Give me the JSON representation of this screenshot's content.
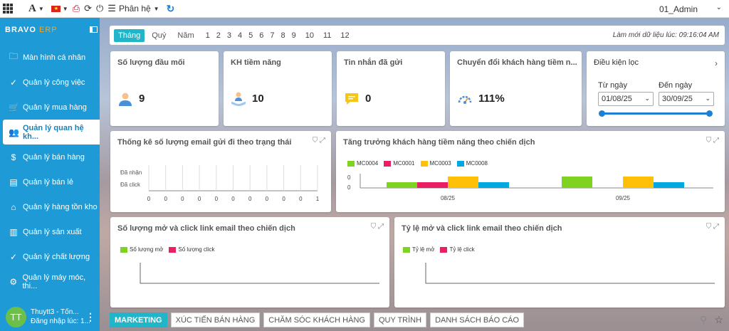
{
  "topbar": {
    "menu_label": "Phân hệ",
    "user": "01_Admin",
    "font_glyph": "A"
  },
  "sidebar": {
    "brand": "BRAVO",
    "brand_suffix": " ERP",
    "items": [
      {
        "label": "Màn hình cá nhân",
        "icon": "folder-icon",
        "glyph": "🗀"
      },
      {
        "label": "Quản lý công việc",
        "icon": "check-circle-icon",
        "glyph": "✓"
      },
      {
        "label": "Quản lý mua hàng",
        "icon": "cart-icon",
        "glyph": "🛒"
      },
      {
        "label": "Quản lý quan hệ kh...",
        "icon": "people-icon",
        "glyph": "👥"
      },
      {
        "label": "Quản lý bán hàng",
        "icon": "dollar-icon",
        "glyph": "$"
      },
      {
        "label": "Quản lý bán lẻ",
        "icon": "receipt-icon",
        "glyph": "▤"
      },
      {
        "label": "Quản lý hàng tồn kho",
        "icon": "warehouse-icon",
        "glyph": "⌂"
      },
      {
        "label": "Quản lý sản xuất",
        "icon": "factory-icon",
        "glyph": "▥"
      },
      {
        "label": "Quản lý chất lượng",
        "icon": "badge-check-icon",
        "glyph": "✓"
      },
      {
        "label": "Quản lý máy móc, thi...",
        "icon": "machine-icon",
        "glyph": "⚙"
      }
    ],
    "user": {
      "initials": "TT",
      "name": "Thuytt3 - Tốn...",
      "login": "Đăng nhập lúc: 1..."
    }
  },
  "periods": {
    "tabs": [
      "Tháng",
      "Quý",
      "Năm"
    ],
    "months": [
      "1",
      "2",
      "3",
      "4",
      "5",
      "6",
      "7",
      "8",
      "9",
      "10",
      "11",
      "12"
    ],
    "last_refresh": "Làm mới dữ liệu lúc: 09:16:04 AM"
  },
  "kpis": [
    {
      "title": "Số lượng đầu mối",
      "value": "9",
      "icon": "person-icon",
      "color": "#4a90d9"
    },
    {
      "title": "KH tiềm năng",
      "value": "10",
      "icon": "hand-person-icon",
      "color": "#4a90d9"
    },
    {
      "title": "Tin nhắn đã gửi",
      "value": "0",
      "icon": "message-icon",
      "color": "#f5c518"
    },
    {
      "title": "Chuyển đổi khách hàng tiềm n...",
      "value": "111%",
      "icon": "gauge-icon",
      "color": "#4a90d9"
    }
  ],
  "filter": {
    "title": "Điều kiện lọc",
    "from_label": "Từ ngày",
    "to_label": "Đến ngày",
    "from_value": "01/08/25",
    "to_value": "30/09/25"
  },
  "charts": {
    "email_status": {
      "title": "Thống kê số lượng email gửi đi theo trạng thái",
      "ylabels": [
        "Đã nhận",
        "Đã click"
      ],
      "xticks": [
        "0",
        "0",
        "0",
        "0",
        "0",
        "0",
        "0",
        "0",
        "0",
        "0",
        "1"
      ]
    },
    "growth": {
      "title": "Tăng trưởng khách hàng tiềm năng theo chiến dịch",
      "yticks": [
        "0",
        "0"
      ],
      "xticks": [
        "08/25",
        "09/25"
      ]
    },
    "open_click_count": {
      "title": "Số lượng mở và click link email theo chiến dịch",
      "legend": [
        "Số lượng mở",
        "Số lượng click"
      ]
    },
    "open_click_rate": {
      "title": "Tỷ lệ mở và click link email theo chiến dịch",
      "legend": [
        "Tỷ lệ mở",
        "Tỷ lệ click"
      ]
    }
  },
  "chart_data": {
    "type": "bar",
    "categories": [
      "08/25",
      "09/25"
    ],
    "series": [
      {
        "name": "MC0004",
        "color": "#7ed321",
        "values": [
          1,
          2
        ]
      },
      {
        "name": "MC0001",
        "color": "#e91e63",
        "values": [
          1,
          0
        ]
      },
      {
        "name": "MC0003",
        "color": "#ffc107",
        "values": [
          2,
          2
        ]
      },
      {
        "name": "MC0008",
        "color": "#00a8e0",
        "values": [
          1,
          1
        ]
      }
    ],
    "legend_position": "top-left"
  },
  "bottom_tabs": [
    "MARKETING",
    "XÚC TIẾN BÁN HÀNG",
    "CHĂM SÓC KHÁCH HÀNG",
    "QUY TRÌNH",
    "DANH SÁCH BÁO CÁO"
  ]
}
